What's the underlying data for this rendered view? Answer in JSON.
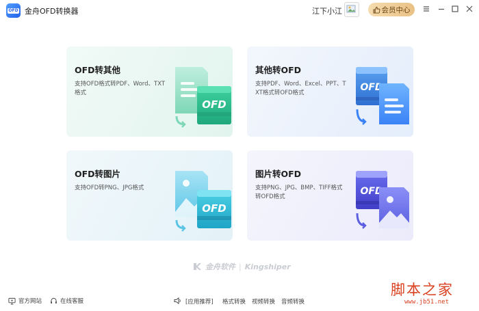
{
  "app": {
    "logo_text": "OFD",
    "title": "金舟OFD转换器"
  },
  "header": {
    "username": "江下小江",
    "member_label": "会员中心"
  },
  "cards": [
    {
      "title": "OFD转其他",
      "desc": "支持OFD格式转PDF、Word、TXT格式",
      "badge": "OFD"
    },
    {
      "title": "其他转OFD",
      "desc": "支持PDF、Word、Excel、PPT、TXT格式转OFD格式",
      "badge": "OFD"
    },
    {
      "title": "OFD转图片",
      "desc": "支持OFD转PNG、JPG格式",
      "badge": "OFD"
    },
    {
      "title": "图片转OFD",
      "desc": "支持PNG、JPG、BMP、TIFF格式转OFD格式",
      "badge": "OFD"
    }
  ],
  "brand": {
    "cn": "金舟软件",
    "sep": "|",
    "en": "Kingshiper"
  },
  "footer": {
    "official_site": "官方网站",
    "support": "在线客服",
    "recommend": "[应用推荐]",
    "format_convert": "格式转换",
    "video_convert": "视频转换",
    "audio_convert": "音频转换"
  },
  "watermark": {
    "text": "脚本之家",
    "url": "www.jb51.net"
  },
  "colors": {
    "member_gold": "#e9c184",
    "accent_blue": "#2563eb",
    "green": "#2fbf8f",
    "teal": "#3fb7d6",
    "purple": "#5b5fe0"
  }
}
